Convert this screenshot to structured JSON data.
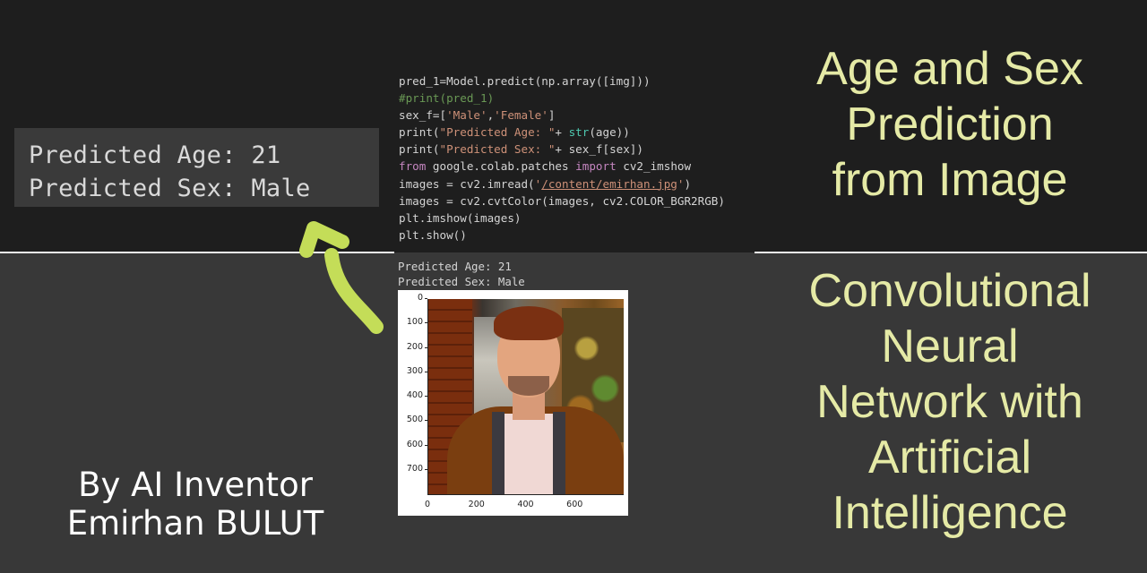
{
  "colors": {
    "top_bg": "#1e1e1e",
    "bottom_bg": "#383838",
    "title_text": "#e5eaa6",
    "arrow": "#c4dd58",
    "code_comment": "#6a9955",
    "code_string": "#ce9178",
    "code_keyword": "#c586c0",
    "code_builtin": "#4ec9b0"
  },
  "output_zoomed": {
    "line1": "Predicted Age: 21",
    "line2": "Predicted Sex: Male"
  },
  "code": {
    "l1": "pred_1=Model.predict(np.array([img]))",
    "l2": "#print(pred_1)",
    "l3a": "sex_f=[",
    "l3b": "'Male'",
    "l3c": ",",
    "l3d": "'Female'",
    "l3e": "]",
    "l4a": "print(",
    "l4b": "\"Predicted Age: \"",
    "l4c": "+ ",
    "l4d": "str",
    "l4e": "(age))",
    "l5a": "print(",
    "l5b": "\"Predicted Sex: \"",
    "l5c": "+ sex_f[sex])",
    "l6a": "from",
    "l6b": " google.colab.patches ",
    "l6c": "import",
    "l6d": " cv2_imshow",
    "l7a": "images = cv2.imread(",
    "l7b": "'",
    "l7c": "/content/emirhan.jpg",
    "l7d": "'",
    "l7e": ")",
    "l8": "images = cv2.cvtColor(images, cv2.COLOR_BGR2RGB)",
    "l9": "plt.imshow(images)",
    "l10": "plt.show()"
  },
  "output_small": {
    "line1": "Predicted Age: 21",
    "line2": "Predicted Sex: Male"
  },
  "plot": {
    "yticks": [
      "0",
      "100",
      "200",
      "300",
      "400",
      "500",
      "600",
      "700"
    ],
    "xticks": [
      "0",
      "200",
      "400",
      "600"
    ],
    "image_description": "portrait photo of a young man in a brown coat"
  },
  "title_top": {
    "line1": "Age and Sex",
    "line2": "Prediction",
    "line3": "from Image"
  },
  "title_bottom": {
    "line1": "Convolutional",
    "line2": "Neural",
    "line3": "Network with",
    "line4": "Artificial",
    "line5": "Intelligence"
  },
  "credit": {
    "line1": "By AI Inventor",
    "line2": "Emirhan BULUT"
  }
}
